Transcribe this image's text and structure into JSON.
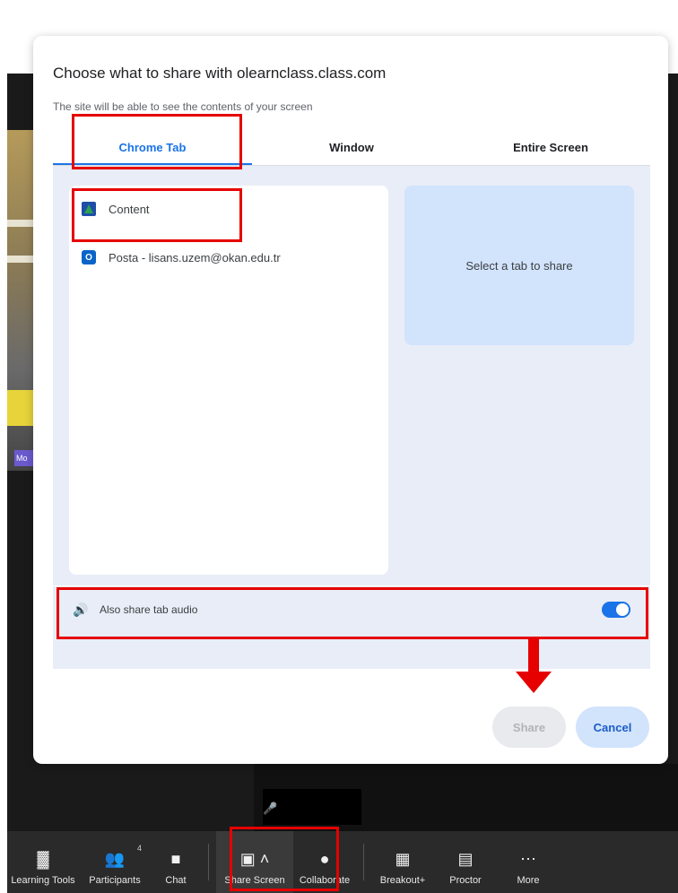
{
  "dialog": {
    "title": "Choose what to share with olearnclass.class.com",
    "subtitle": "The site will be able to see the contents of your screen",
    "tabs": [
      {
        "label": "Chrome Tab",
        "active": true
      },
      {
        "label": "Window",
        "active": false
      },
      {
        "label": "Entire Screen",
        "active": false
      }
    ],
    "tab_list": [
      {
        "label": "Content",
        "icon": "google-classroom-icon"
      },
      {
        "label": "Posta - lisans.uzem@okan.edu.tr",
        "icon": "outlook-icon"
      }
    ],
    "preview_text": "Select a tab to share",
    "audio": {
      "label": "Also share tab audio",
      "enabled": true
    },
    "share_label": "Share",
    "cancel_label": "Cancel"
  },
  "video": {
    "badge": "Mo"
  },
  "toolbar": {
    "items": [
      {
        "label": "Learning Tools",
        "icon": "learning-tools-icon"
      },
      {
        "label": "Participants",
        "icon": "participants-icon",
        "count": "4"
      },
      {
        "label": "Chat",
        "icon": "chat-icon"
      },
      {
        "label": "Share Screen",
        "icon": "share-screen-icon"
      },
      {
        "label": "Collaborate",
        "icon": "collaborate-icon"
      },
      {
        "label": "Breakout+",
        "icon": "breakout-icon"
      },
      {
        "label": "Proctor",
        "icon": "proctor-icon"
      },
      {
        "label": "More",
        "icon": "more-icon"
      }
    ]
  },
  "colors": {
    "accent": "#1a73e8",
    "highlight": "#e60000",
    "panel": "#e8edf7",
    "preview": "#d2e3fc",
    "toolbar": "#2a2a2a"
  }
}
